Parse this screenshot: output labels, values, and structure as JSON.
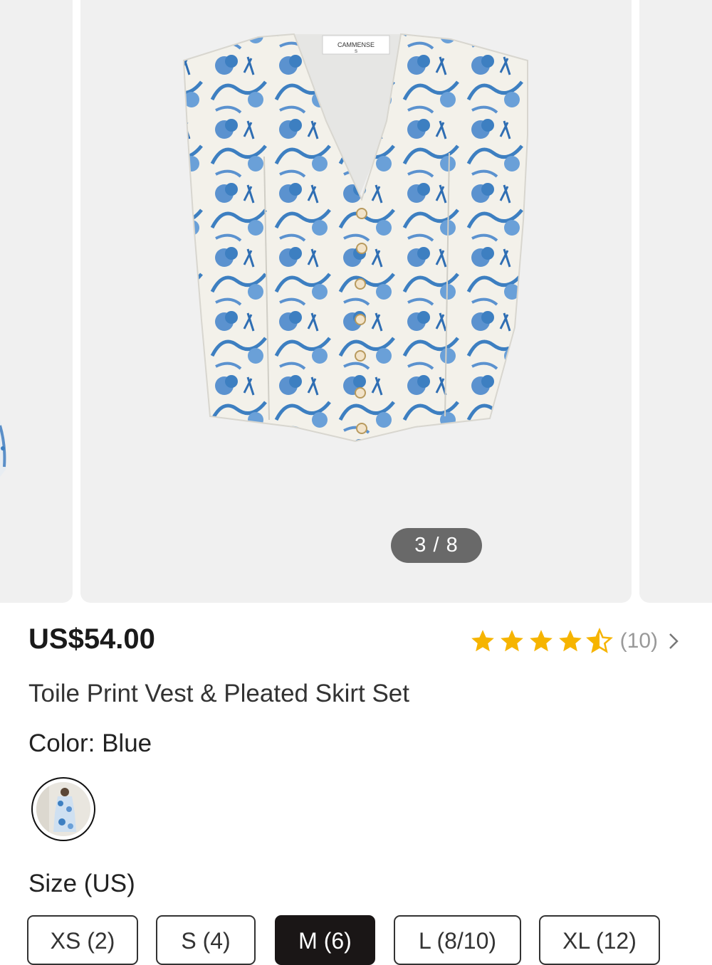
{
  "gallery": {
    "counter": "3 / 8",
    "brand_label": "CAMMENSE",
    "tag_size": "S"
  },
  "product": {
    "price": "US$54.00",
    "rating": 4.5,
    "review_count": "(10)",
    "title": "Toile Print Vest & Pleated Skirt Set"
  },
  "color": {
    "label": "Color: Blue",
    "selected": "Blue"
  },
  "size": {
    "label": "Size (US)",
    "options": [
      "XS (2)",
      "S (4)",
      "M (6)",
      "L (8/10)",
      "XL (12)"
    ],
    "selected": "M (6)"
  },
  "colors": {
    "star": "#f6b400",
    "selected_bg": "#1a1616",
    "toile_blue": "#3d7fc1"
  }
}
